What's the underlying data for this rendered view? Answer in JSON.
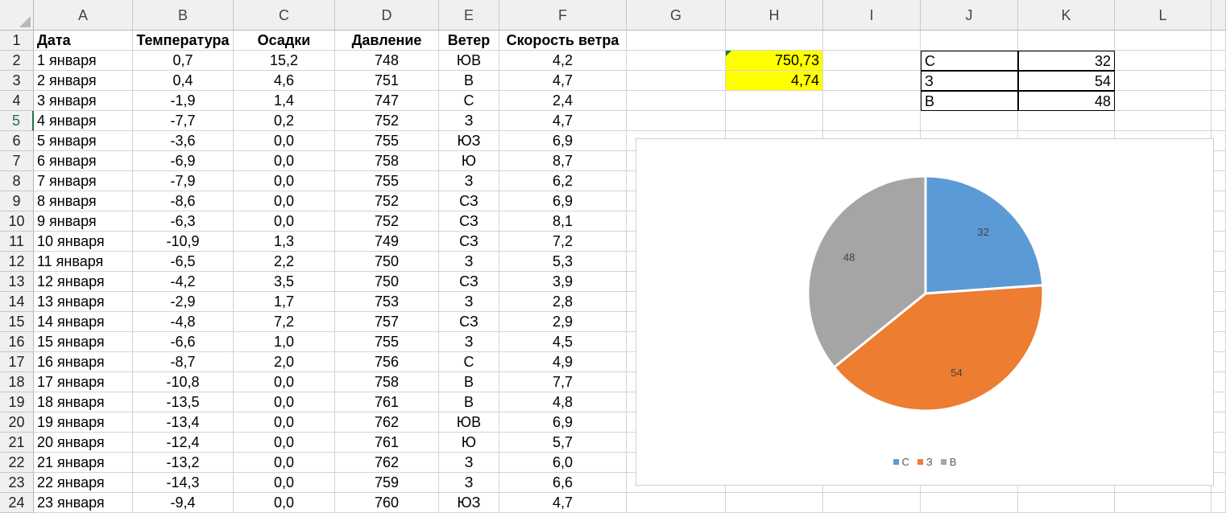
{
  "sheet": {
    "columns": [
      "A",
      "B",
      "C",
      "D",
      "E",
      "F",
      "G",
      "H",
      "I",
      "J",
      "K",
      "L"
    ],
    "row_numbers": [
      "1",
      "2",
      "3",
      "4",
      "5",
      "6",
      "7",
      "8",
      "9",
      "10",
      "11",
      "12",
      "13",
      "14",
      "15",
      "16",
      "17",
      "18",
      "19",
      "20",
      "21",
      "22",
      "23",
      "24"
    ],
    "active_row": "5",
    "headers": [
      "Дата",
      "Температура",
      "Осадки",
      "Давление",
      "Ветер",
      "Скорость ветра"
    ],
    "rows": [
      [
        "1 января",
        "0,7",
        "15,2",
        "748",
        "ЮВ",
        "4,2"
      ],
      [
        "2 января",
        "0,4",
        "4,6",
        "751",
        "В",
        "4,7"
      ],
      [
        "3 января",
        "-1,9",
        "1,4",
        "747",
        "С",
        "2,4"
      ],
      [
        "4 января",
        "-7,7",
        "0,2",
        "752",
        "З",
        "4,7"
      ],
      [
        "5 января",
        "-3,6",
        "0,0",
        "755",
        "ЮЗ",
        "6,9"
      ],
      [
        "6 января",
        "-6,9",
        "0,0",
        "758",
        "Ю",
        "8,7"
      ],
      [
        "7 января",
        "-7,9",
        "0,0",
        "755",
        "З",
        "6,2"
      ],
      [
        "8 января",
        "-8,6",
        "0,0",
        "752",
        "СЗ",
        "6,9"
      ],
      [
        "9 января",
        "-6,3",
        "0,0",
        "752",
        "СЗ",
        "8,1"
      ],
      [
        "10 января",
        "-10,9",
        "1,3",
        "749",
        "СЗ",
        "7,2"
      ],
      [
        "11 января",
        "-6,5",
        "2,2",
        "750",
        "З",
        "5,3"
      ],
      [
        "12 января",
        "-4,2",
        "3,5",
        "750",
        "СЗ",
        "3,9"
      ],
      [
        "13 января",
        "-2,9",
        "1,7",
        "753",
        "З",
        "2,8"
      ],
      [
        "14 января",
        "-4,8",
        "7,2",
        "757",
        "СЗ",
        "2,9"
      ],
      [
        "15 января",
        "-6,6",
        "1,0",
        "755",
        "З",
        "4,5"
      ],
      [
        "16 января",
        "-8,7",
        "2,0",
        "756",
        "С",
        "4,9"
      ],
      [
        "17 января",
        "-10,8",
        "0,0",
        "758",
        "В",
        "7,7"
      ],
      [
        "18 января",
        "-13,5",
        "0,0",
        "761",
        "В",
        "4,8"
      ],
      [
        "19 января",
        "-13,4",
        "0,0",
        "762",
        "ЮВ",
        "6,9"
      ],
      [
        "20 января",
        "-12,4",
        "0,0",
        "761",
        "Ю",
        "5,7"
      ],
      [
        "21 января",
        "-13,2",
        "0,0",
        "762",
        "З",
        "6,0"
      ],
      [
        "22 января",
        "-14,3",
        "0,0",
        "759",
        "З",
        "6,6"
      ],
      [
        "23 января",
        "-9,4",
        "0,0",
        "760",
        "ЮЗ",
        "4,7"
      ]
    ],
    "summary_h": [
      "750,73",
      "4,74"
    ],
    "summary_table": [
      [
        "С",
        "32"
      ],
      [
        "З",
        "54"
      ],
      [
        "В",
        "48"
      ]
    ]
  },
  "chart_data": {
    "type": "pie",
    "categories": [
      "С",
      "З",
      "В"
    ],
    "values": [
      32,
      54,
      48
    ],
    "data_labels": [
      "32",
      "54",
      "48"
    ],
    "colors": [
      "#5b9bd5",
      "#ed7d31",
      "#a5a5a5"
    ],
    "legend_position": "bottom",
    "start_angle_deg": 0
  }
}
